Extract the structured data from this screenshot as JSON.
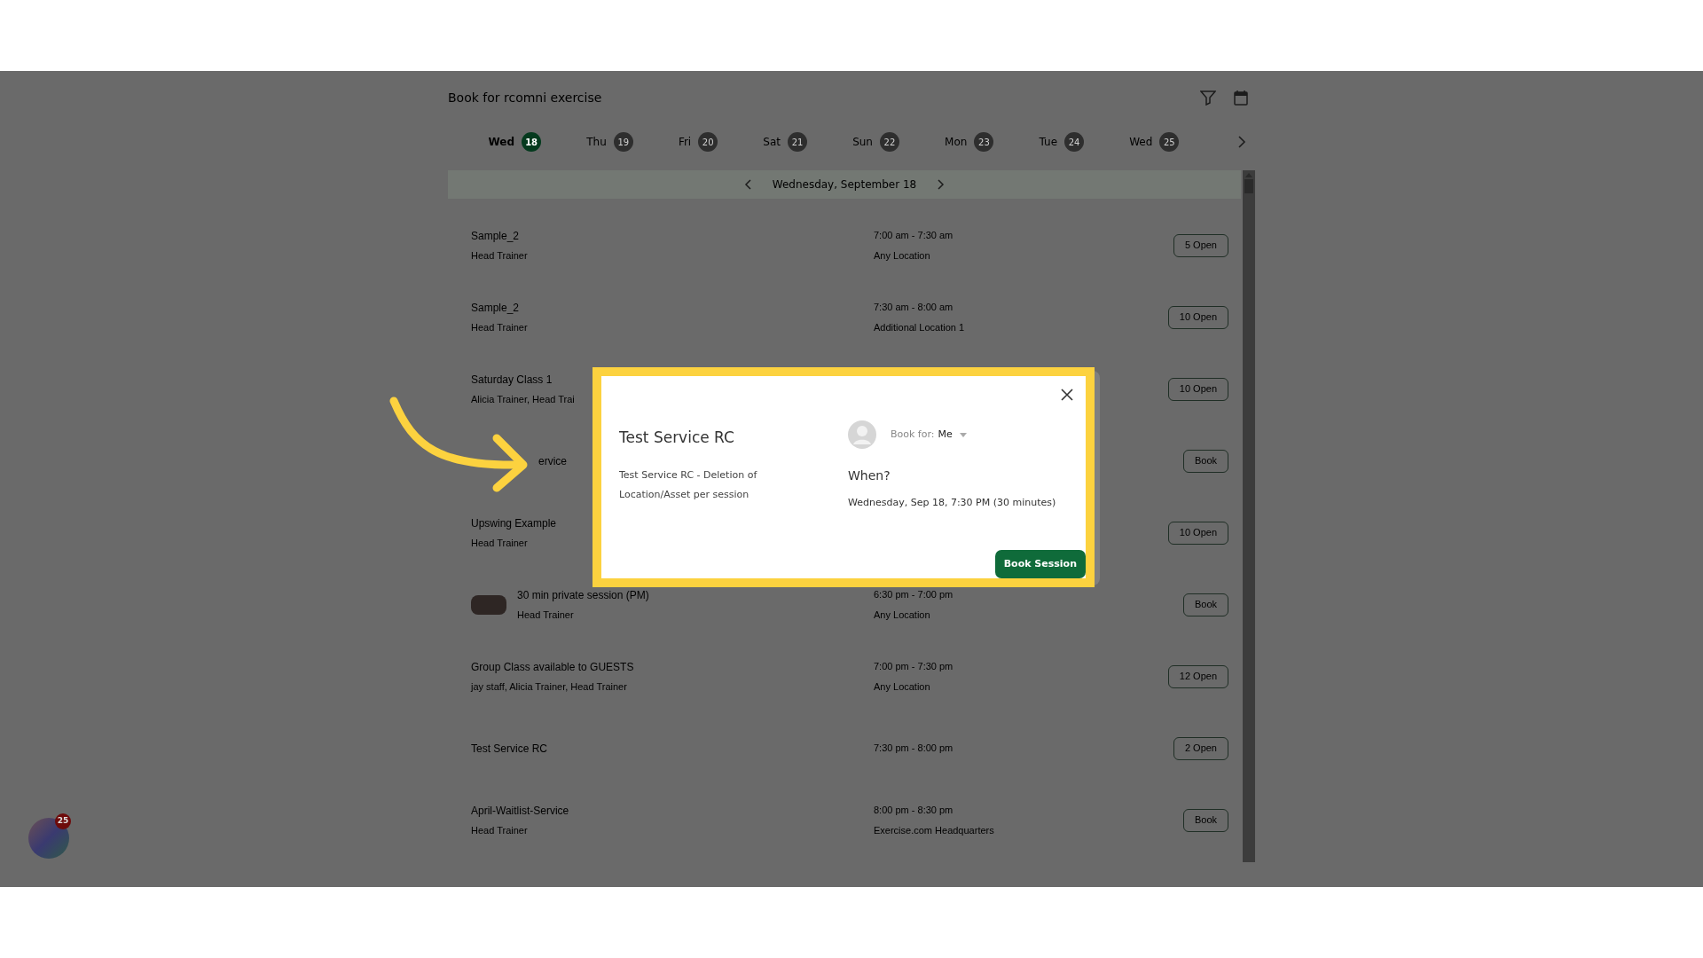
{
  "header": {
    "title": "Book for rcomni exercise"
  },
  "days": [
    {
      "weekday": "Wed",
      "date": "18",
      "selected": true
    },
    {
      "weekday": "Thu",
      "date": "19",
      "selected": false
    },
    {
      "weekday": "Fri",
      "date": "20",
      "selected": false
    },
    {
      "weekday": "Sat",
      "date": "21",
      "selected": false
    },
    {
      "weekday": "Sun",
      "date": "22",
      "selected": false
    },
    {
      "weekday": "Mon",
      "date": "23",
      "selected": false
    },
    {
      "weekday": "Tue",
      "date": "24",
      "selected": false
    },
    {
      "weekday": "Wed",
      "date": "25",
      "selected": false
    }
  ],
  "date_nav": {
    "label": "Wednesday, September 18"
  },
  "sessions": [
    {
      "title": "Sample_2",
      "staff": "Head Trainer",
      "time": "7:00 am - 7:30 am",
      "location": "Any Location",
      "action": "5 Open",
      "thumbnail": false,
      "covered": false
    },
    {
      "title": "Sample_2",
      "staff": "Head Trainer",
      "time": "7:30 am - 8:00 am",
      "location": "Additional Location 1",
      "action": "10 Open",
      "thumbnail": false,
      "covered": false
    },
    {
      "title": "Saturday Class 1",
      "staff": "Alicia Trainer, Head Trai",
      "action": "10 Open",
      "thumbnail": false,
      "covered": false
    },
    {
      "title": "ervice",
      "action": "Book",
      "thumbnail": false,
      "covered": true
    },
    {
      "title": "Upswing Example",
      "staff": "Head Trainer",
      "action": "10 Open",
      "thumbnail": false,
      "covered": false
    },
    {
      "title": "30 min private session (PM)",
      "staff": "Head Trainer",
      "time": "6:30 pm - 7:00 pm",
      "location": "Any Location",
      "action": "Book",
      "thumbnail": true,
      "covered": false
    },
    {
      "title": "Group Class available to GUESTS",
      "staff": "jay staff, Alicia Trainer, Head Trainer",
      "time": "7:00 pm - 7:30 pm",
      "location": "Any Location",
      "action": "12 Open",
      "thumbnail": false,
      "covered": false
    },
    {
      "title": "Test Service RC",
      "time": "7:30 pm - 8:00 pm",
      "action": "2 Open",
      "thumbnail": false,
      "covered": false
    },
    {
      "title": "April-Waitlist-Service",
      "staff": "Head Trainer",
      "time": "8:00 pm - 8:30 pm",
      "location": "Exercise.com Headquarters",
      "action": "Book",
      "thumbnail": false,
      "covered": false
    }
  ],
  "modal": {
    "title": "Test Service RC",
    "description": "Test Service RC - Deletion of Location/Asset per session",
    "book_for_label": "Book for:",
    "book_for_value": "Me",
    "when_heading": "When?",
    "when": "Wednesday, Sep 18, 7:30 PM (30 minutes)",
    "button": "Book Session"
  },
  "chat_badge": {
    "count": "25"
  }
}
